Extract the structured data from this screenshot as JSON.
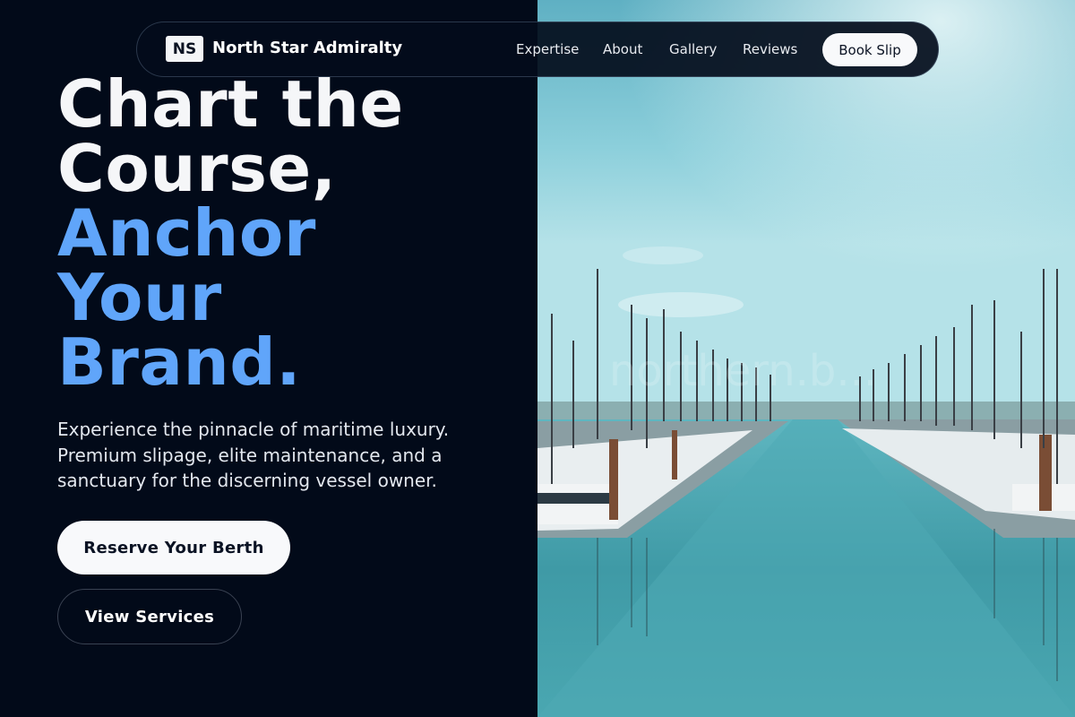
{
  "nav": {
    "logo_text": "NS",
    "brand": "North Star Admiralty",
    "links": [
      "Expertise",
      "About",
      "Gallery",
      "Reviews"
    ],
    "cta": "Book Slip"
  },
  "hero": {
    "headline_lines": [
      "Chart the",
      "Course,"
    ],
    "accent_lines": [
      "Anchor",
      "Your",
      "Brand."
    ],
    "subtext": "Experience the pinnacle of maritime luxury. Premium slipage, elite maintenance, and a sanctuary for the discerning vessel owner.",
    "primary_button": "Reserve Your Berth",
    "secondary_button": "View Services",
    "image_watermark": "northern.b..."
  },
  "colors": {
    "background": "#020a19",
    "accent": "#60a5fa",
    "button_light": "#f8f9fb"
  }
}
